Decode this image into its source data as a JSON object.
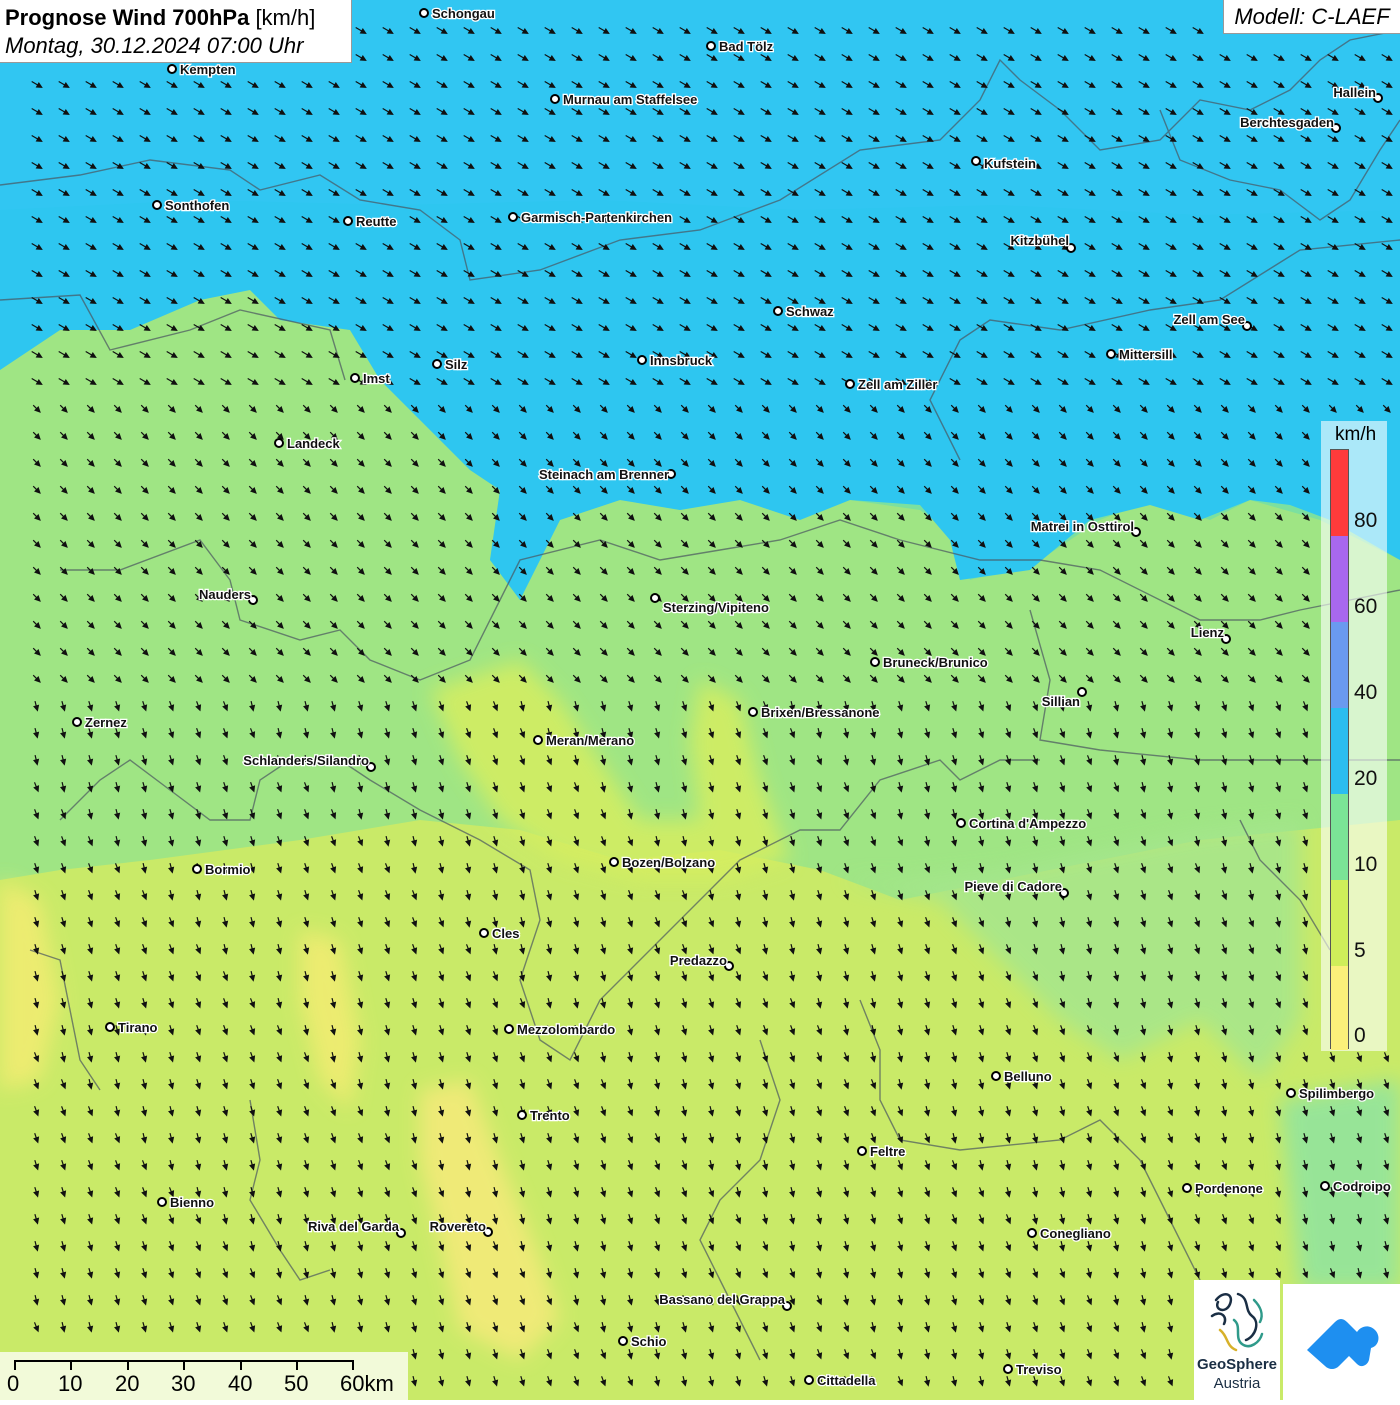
{
  "title": {
    "main": "Prognose Wind 700hPa",
    "unit": "[km/h]",
    "date": "Montag, 30.12.2024 07:00 Uhr"
  },
  "model": "Modell: C-LAEF",
  "legend": {
    "unit": "km/h",
    "labels": [
      "80",
      "60",
      "40",
      "20",
      "10",
      "5",
      "0"
    ],
    "colors": [
      "#ff3b3b",
      "#a868ee",
      "#6a9af0",
      "#2bbdf0",
      "#7be496",
      "#cfee5a",
      "#fbf07a"
    ]
  },
  "scalebar": {
    "labels": [
      "0",
      "10",
      "20",
      "30",
      "40",
      "50",
      "60km"
    ]
  },
  "logo": {
    "geosphere_line1": "GeoSphere",
    "geosphere_line2": "Austria"
  },
  "cities": [
    {
      "name": "Schongau"
    },
    {
      "name": "Kempten"
    },
    {
      "name": "Bad Tölz"
    },
    {
      "name": "Murnau am Staffelsee"
    },
    {
      "name": "Hallein"
    },
    {
      "name": "Berchtesgaden"
    },
    {
      "name": "Kufstein"
    },
    {
      "name": "Sonthofen"
    },
    {
      "name": "Reutte"
    },
    {
      "name": "Garmisch-Partenkirchen"
    },
    {
      "name": "Kitzbühel"
    },
    {
      "name": "Schwaz"
    },
    {
      "name": "Zell am See"
    },
    {
      "name": "Mittersill"
    },
    {
      "name": "Innsbruck"
    },
    {
      "name": "Silz"
    },
    {
      "name": "Imst"
    },
    {
      "name": "Zell am Ziller"
    },
    {
      "name": "Landeck"
    },
    {
      "name": "Steinach am Brenner"
    },
    {
      "name": "Matrei in Osttirol"
    },
    {
      "name": "Nauders"
    },
    {
      "name": "Sterzing/Vipiteno"
    },
    {
      "name": "Lienz"
    },
    {
      "name": "Bruneck/Brunico"
    },
    {
      "name": "Sillian"
    },
    {
      "name": "Brixen/Bressanone"
    },
    {
      "name": "Zernez"
    },
    {
      "name": "Meran/Merano"
    },
    {
      "name": "Schlanders/Silandro"
    },
    {
      "name": "Cortina d'Ampezzo"
    },
    {
      "name": "Bozen/Bolzano"
    },
    {
      "name": "Bormio"
    },
    {
      "name": "Pieve di Cadore"
    },
    {
      "name": "Cles"
    },
    {
      "name": "Predazzo"
    },
    {
      "name": "Tirano"
    },
    {
      "name": "Mezzolombardo"
    },
    {
      "name": "Belluno"
    },
    {
      "name": "Spilimbergo"
    },
    {
      "name": "Trento"
    },
    {
      "name": "Feltre"
    },
    {
      "name": "Pordenone"
    },
    {
      "name": "Codroipo"
    },
    {
      "name": "Bienno"
    },
    {
      "name": "Riva del Garda"
    },
    {
      "name": "Rovereto"
    },
    {
      "name": "Conegliano"
    },
    {
      "name": "Bassano del Grappa"
    },
    {
      "name": "Schio"
    },
    {
      "name": "Treviso"
    },
    {
      "name": "Cittadella"
    }
  ]
}
